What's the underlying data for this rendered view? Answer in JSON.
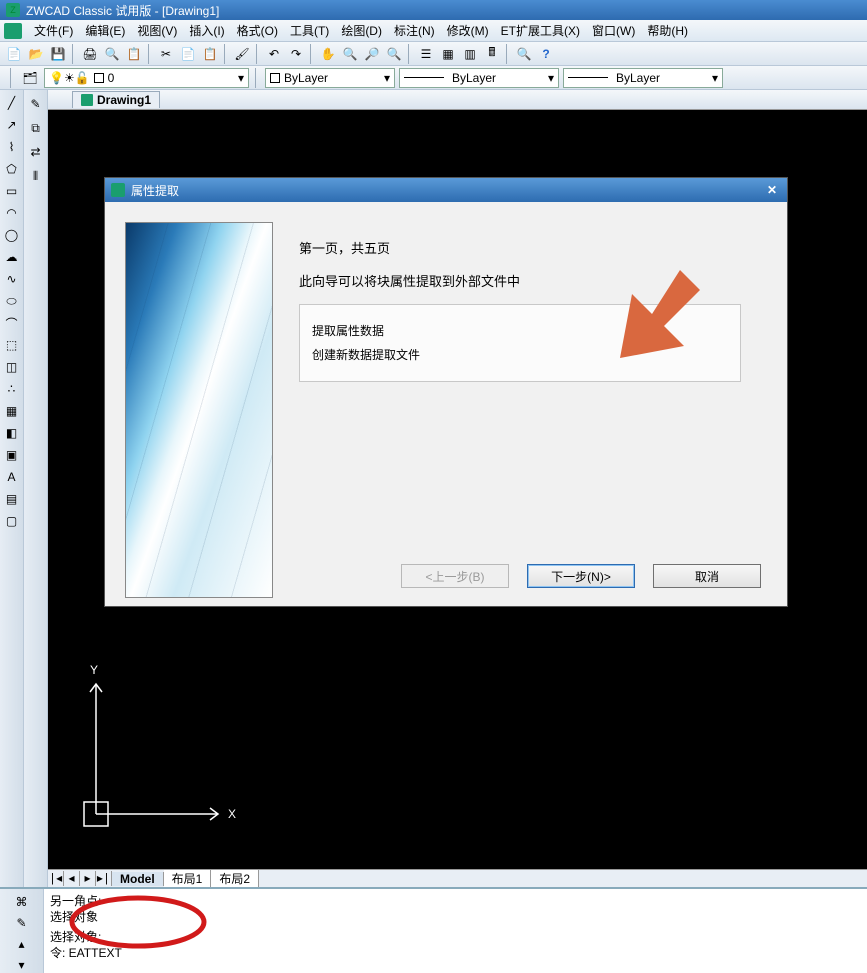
{
  "app": {
    "title": "ZWCAD Classic 试用版 - [Drawing1]"
  },
  "menu": {
    "items": [
      "文件(F)",
      "编辑(E)",
      "视图(V)",
      "插入(I)",
      "格式(O)",
      "工具(T)",
      "绘图(D)",
      "标注(N)",
      "修改(M)",
      "ET扩展工具(X)",
      "窗口(W)",
      "帮助(H)"
    ]
  },
  "layer": {
    "current": "0",
    "bylayer1": "ByLayer",
    "bylayer2": "ByLayer",
    "bylayer3": "ByLayer"
  },
  "docTab": {
    "label": "Drawing1"
  },
  "layoutTabs": {
    "items": [
      "Model",
      "布局1",
      "布局2"
    ]
  },
  "ucs": {
    "x": "X",
    "y": "Y"
  },
  "command": {
    "line1": "另一角点:",
    "line2": "选择对象",
    "line3": "选择对象:",
    "line4": "令: EATTEXT"
  },
  "dialog": {
    "title": "属性提取",
    "heading": "第一页，共五页",
    "desc": "此向导可以将块属性提取到外部文件中",
    "opt1": "提取属性数据",
    "opt2": "创建新数据提取文件",
    "btnPrev": "<上一步(B)",
    "btnNext": "下一步(N)>",
    "btnCancel": "取消"
  }
}
